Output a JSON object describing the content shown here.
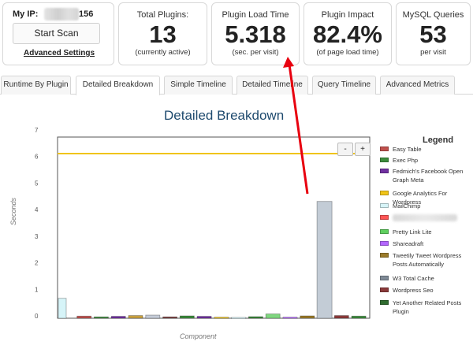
{
  "ip_box": {
    "label": "My IP:",
    "suffix": "156",
    "start_button": "Start Scan",
    "advanced_link": "Advanced Settings"
  },
  "stats": {
    "plugins": {
      "label": "Total Plugins:",
      "value": "13",
      "sub": "(currently active)"
    },
    "load_time": {
      "label": "Plugin Load Time",
      "value": "5.318",
      "sub": "(sec. per visit)"
    },
    "impact": {
      "label": "Plugin Impact",
      "value": "82.4%",
      "sub": "(of page load time)"
    },
    "mysql": {
      "label": "MySQL Queries",
      "value": "53",
      "sub": "per visit"
    }
  },
  "tabs": [
    {
      "label": "Runtime By Plugin",
      "active": false
    },
    {
      "label": "Detailed Breakdown",
      "active": true
    },
    {
      "label": "Simple Timeline",
      "active": false
    },
    {
      "label": "Detailed Timeline",
      "active": false
    },
    {
      "label": "Query Timeline",
      "active": false
    },
    {
      "label": "Advanced Metrics",
      "active": false
    }
  ],
  "zoom": {
    "minus": "-",
    "plus": "+"
  },
  "colors": {
    "reference_line": "#f0c419",
    "annotation_arrow": "#e8000f",
    "title": "#1e4a6e"
  },
  "chart_data": {
    "type": "bar",
    "title": "Detailed Breakdown",
    "xlabel": "Component",
    "ylabel": "Seconds",
    "ylim": [
      0,
      7
    ],
    "yticks": [
      "0",
      "1",
      "2",
      "3",
      "4",
      "5",
      "6",
      "7"
    ],
    "reference_line": 6.2,
    "legend_title": "Legend",
    "legend_position": "right",
    "bars": [
      {
        "value": 0.75,
        "color": "#d6f4f8"
      },
      {
        "value": 0.08,
        "color": "#c0504d"
      },
      {
        "value": 0.05,
        "color": "#3c8c3c"
      },
      {
        "value": 0.07,
        "color": "#7030a0"
      },
      {
        "value": 0.1,
        "color": "#c8a040"
      },
      {
        "value": 0.12,
        "color": "#c5ccd8"
      },
      {
        "value": 0.05,
        "color": "#7a3b3b"
      },
      {
        "value": 0.09,
        "color": "#3c8c3c"
      },
      {
        "value": 0.07,
        "color": "#7030a0"
      },
      {
        "value": 0.04,
        "color": "#f0c419"
      },
      {
        "value": 0.03,
        "color": "#d6f4f8"
      },
      {
        "value": 0.06,
        "color": "#3c8c3c"
      },
      {
        "value": 0.16,
        "color": "#7fd67f"
      },
      {
        "value": 0.04,
        "color": "#b366ff"
      },
      {
        "value": 0.09,
        "color": "#9b7b2a"
      },
      {
        "value": 4.4,
        "color": "#c3ccd6"
      },
      {
        "value": 0.1,
        "color": "#8b3a3a"
      },
      {
        "value": 0.08,
        "color": "#3c8c3c"
      }
    ],
    "legend": [
      {
        "name": "Easy Table",
        "color": "#c0504d"
      },
      {
        "name": "Exec Php",
        "color": "#3c8c3c"
      },
      {
        "name": "Fedmich's Facebook Open Graph Meta",
        "color": "#7030a0"
      },
      {
        "name": "Google Analytics For Wordpress",
        "color": "#f0c419"
      },
      {
        "name": "MailChimp",
        "color": "#d6f4f8"
      },
      {
        "name": "",
        "color": "#ff5555",
        "redacted": true
      },
      {
        "name": "Pretty Link Lite",
        "color": "#5fcf5f"
      },
      {
        "name": "Shareadraft",
        "color": "#b366ff"
      },
      {
        "name": "Tweetily Tweet Wordpress Posts Automatically",
        "color": "#9b7b2a"
      },
      {
        "name": "W3 Total Cache",
        "color": "#7f8a96"
      },
      {
        "name": "Wordpress Seo",
        "color": "#8b3a3a"
      },
      {
        "name": "Yet Another Related Posts Plugin",
        "color": "#2f6b2f"
      }
    ]
  }
}
